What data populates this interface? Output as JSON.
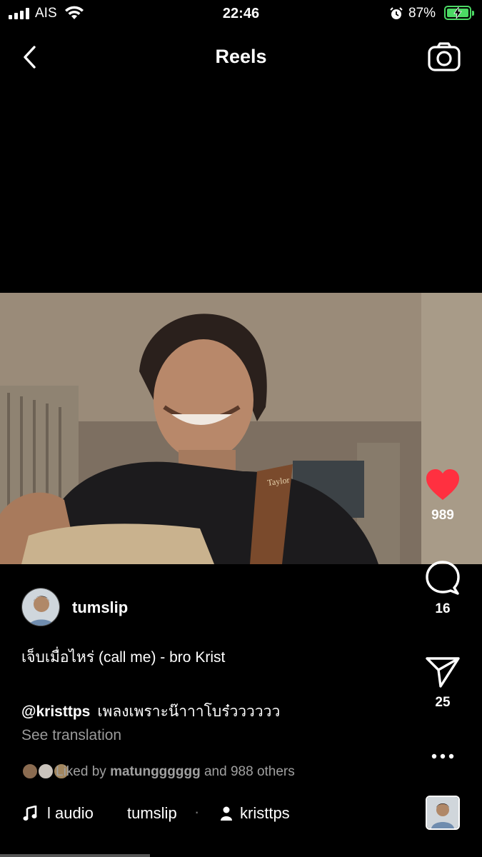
{
  "status_bar": {
    "carrier": "AIS",
    "time": "22:46",
    "battery_percent": "87%",
    "battery_level": 0.87,
    "colors": {
      "battery": "#4cd964"
    }
  },
  "header": {
    "title": "Reels",
    "back_icon": "chevron-left-icon",
    "camera_icon": "camera-icon"
  },
  "actions": {
    "likes": "989",
    "comments": "16",
    "shares": "25",
    "colors": {
      "like": "#ff3040"
    }
  },
  "post": {
    "username": "tumslip",
    "song_title": "เจ็บเมื่อไหร่ (call me) - bro Krist",
    "caption_mention": "@kristtps",
    "caption_text": "เพลงเพราะน๊าาาโบร๋วววววว",
    "see_translation": "See translation",
    "liked_prefix": "Liked by",
    "liked_user": "matungggggg",
    "liked_suffix": "and 988 others"
  },
  "audio": {
    "audio_label": "l audio",
    "audio_user": "tumslip",
    "tagged_user": "kristtps"
  }
}
